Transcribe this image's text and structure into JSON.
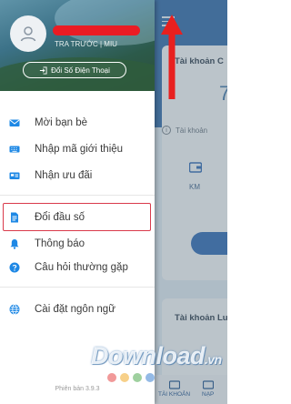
{
  "drawer": {
    "user_subtitle": "TRA TRƯỚC | MIU",
    "change_number_button": "Đổi Số Điện Thoại",
    "menu": [
      {
        "label": "Mời bạn bè",
        "icon": "envelope-icon"
      },
      {
        "label": "Nhập mã giới thiệu",
        "icon": "keyboard-icon"
      },
      {
        "label": "Nhận ưu đãi",
        "icon": "gift-card-icon"
      },
      {
        "label": "Đổi đầu số",
        "icon": "document-icon"
      },
      {
        "label": "Thông báo",
        "icon": "bell-icon"
      },
      {
        "label": "Câu hỏi thường gặp",
        "icon": "question-icon"
      },
      {
        "label": "Cài đặt ngôn ngữ",
        "icon": "globe-icon"
      }
    ],
    "version": "Phiên bản 3.9.3"
  },
  "background": {
    "card1_title": "Tài khoản C",
    "big_value": "7",
    "info_text": "Tài khoản",
    "km_label": "KM",
    "card2_title": "Tài khoản Lư",
    "tabs": [
      "TÀI KHOẢN",
      "NẠP"
    ]
  },
  "watermark": {
    "text": "Download",
    "suffix": ".vn"
  },
  "colors": {
    "accent": "#1e88e5",
    "highlight": "#d93a4b",
    "arrow": "#e8201f",
    "app_blue": "#3b74ae"
  }
}
